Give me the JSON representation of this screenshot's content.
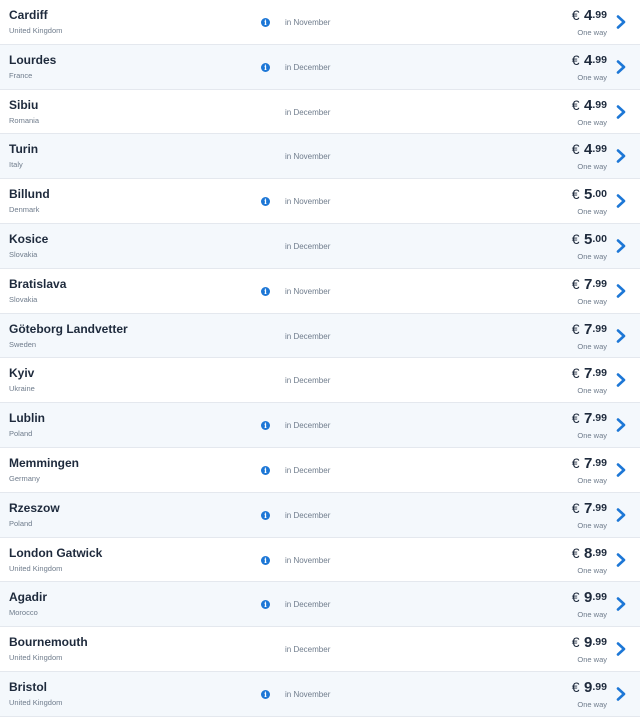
{
  "icons": {
    "info": "info-icon",
    "next": "chevron-right-icon"
  },
  "colors": {
    "accent": "#1d77d6",
    "text": "#1e2a3c",
    "muted": "#6f7c8c",
    "row_alt": "#f4f8fc"
  },
  "fares": [
    {
      "city": "Cardiff",
      "country": "United Kingdom",
      "has_info": true,
      "month": "in November",
      "currency": "€",
      "whole": "4",
      "cents": ".99",
      "fare_type": "One way"
    },
    {
      "city": "Lourdes",
      "country": "France",
      "has_info": true,
      "month": "in December",
      "currency": "€",
      "whole": "4",
      "cents": ".99",
      "fare_type": "One way"
    },
    {
      "city": "Sibiu",
      "country": "Romania",
      "has_info": false,
      "month": "in December",
      "currency": "€",
      "whole": "4",
      "cents": ".99",
      "fare_type": "One way"
    },
    {
      "city": "Turin",
      "country": "Italy",
      "has_info": false,
      "month": "in November",
      "currency": "€",
      "whole": "4",
      "cents": ".99",
      "fare_type": "One way"
    },
    {
      "city": "Billund",
      "country": "Denmark",
      "has_info": true,
      "month": "in November",
      "currency": "€",
      "whole": "5",
      "cents": ".00",
      "fare_type": "One way"
    },
    {
      "city": "Kosice",
      "country": "Slovakia",
      "has_info": false,
      "month": "in December",
      "currency": "€",
      "whole": "5",
      "cents": ".00",
      "fare_type": "One way"
    },
    {
      "city": "Bratislava",
      "country": "Slovakia",
      "has_info": true,
      "month": "in November",
      "currency": "€",
      "whole": "7",
      "cents": ".99",
      "fare_type": "One way"
    },
    {
      "city": "Göteborg Landvetter",
      "country": "Sweden",
      "has_info": false,
      "month": "in December",
      "currency": "€",
      "whole": "7",
      "cents": ".99",
      "fare_type": "One way"
    },
    {
      "city": "Kyiv",
      "country": "Ukraine",
      "has_info": false,
      "month": "in December",
      "currency": "€",
      "whole": "7",
      "cents": ".99",
      "fare_type": "One way"
    },
    {
      "city": "Lublin",
      "country": "Poland",
      "has_info": true,
      "month": "in December",
      "currency": "€",
      "whole": "7",
      "cents": ".99",
      "fare_type": "One way"
    },
    {
      "city": "Memmingen",
      "country": "Germany",
      "has_info": true,
      "month": "in December",
      "currency": "€",
      "whole": "7",
      "cents": ".99",
      "fare_type": "One way"
    },
    {
      "city": "Rzeszow",
      "country": "Poland",
      "has_info": true,
      "month": "in December",
      "currency": "€",
      "whole": "7",
      "cents": ".99",
      "fare_type": "One way"
    },
    {
      "city": "London Gatwick",
      "country": "United Kingdom",
      "has_info": true,
      "month": "in November",
      "currency": "€",
      "whole": "8",
      "cents": ".99",
      "fare_type": "One way"
    },
    {
      "city": "Agadir",
      "country": "Morocco",
      "has_info": true,
      "month": "in December",
      "currency": "€",
      "whole": "9",
      "cents": ".99",
      "fare_type": "One way"
    },
    {
      "city": "Bournemouth",
      "country": "United Kingdom",
      "has_info": false,
      "month": "in December",
      "currency": "€",
      "whole": "9",
      "cents": ".99",
      "fare_type": "One way"
    },
    {
      "city": "Bristol",
      "country": "United Kingdom",
      "has_info": true,
      "month": "in November",
      "currency": "€",
      "whole": "9",
      "cents": ".99",
      "fare_type": "One way"
    }
  ]
}
